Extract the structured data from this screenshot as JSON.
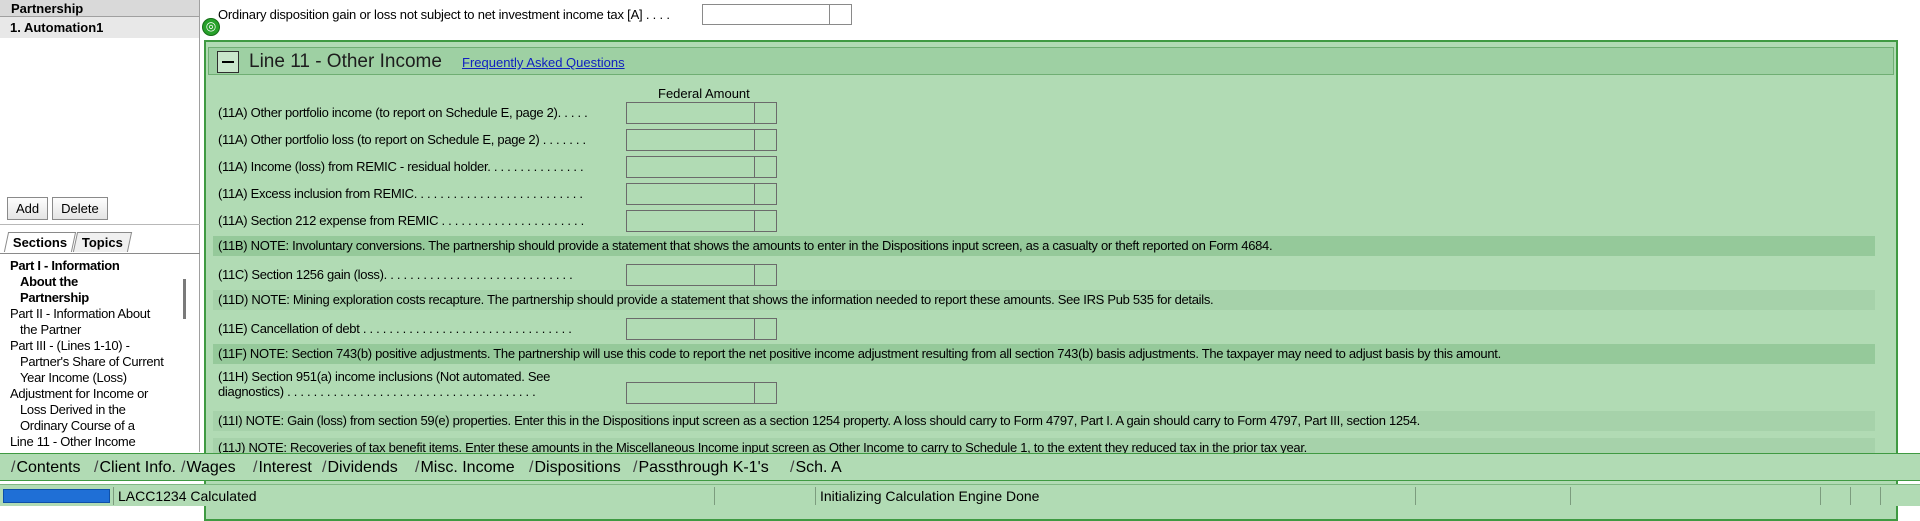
{
  "left_panel": {
    "header": "Partnership",
    "selected_item": "1. Automation1",
    "add_label": "Add",
    "delete_label": "Delete",
    "tabs": [
      {
        "label": "Sections",
        "active": true
      },
      {
        "label": "Topics",
        "active": false
      }
    ],
    "sections": [
      {
        "first": "Part I - Information",
        "rest": [
          "About the",
          "Partnership"
        ],
        "bold": true
      },
      {
        "first": "Part II - Information About",
        "rest": [
          "the Partner"
        ],
        "bold": false
      },
      {
        "first": "Part III - (Lines 1-10) -",
        "rest": [
          "Partner's Share of Current",
          "Year Income (Loss)"
        ],
        "bold": false
      },
      {
        "first": "Adjustment for Income or",
        "rest": [
          "Loss Derived in the",
          "Ordinary Course of a"
        ],
        "bold": false
      },
      {
        "first": "Line 11 - Other Income",
        "rest": [],
        "bold": false
      }
    ]
  },
  "top_row": {
    "label": "Ordinary disposition gain or loss not subject to net investment income tax [A] . . . .",
    "value": ""
  },
  "section": {
    "title": "Line 11 - Other Income",
    "faq_link": "Frequently Asked Questions",
    "column_header": "Federal Amount",
    "rows": [
      {
        "type": "field",
        "label": "(11A) Other portfolio income (to report on Schedule E, page 2). . . . .",
        "value": ""
      },
      {
        "type": "field",
        "label": "(11A) Other portfolio loss (to report on Schedule E, page 2) . . . . . . .",
        "value": ""
      },
      {
        "type": "field",
        "label": "(11A) Income (loss) from REMIC - residual holder. . . . . . . . . . . . . . .",
        "value": ""
      },
      {
        "type": "field",
        "label": "(11A) Excess inclusion from REMIC. . . . . . . . . . . . . . . . . . . . . . . . . .",
        "value": ""
      },
      {
        "type": "field",
        "label": "(11A) Section 212 expense from REMIC . . . . . . . . . . . . . . . . . . . . . .",
        "value": ""
      },
      {
        "type": "note",
        "label": "(11B) NOTE: Involuntary conversions. The partnership should provide a statement that shows the amounts to enter in the Dispositions input screen, as a casualty or theft reported on Form 4684."
      },
      {
        "type": "field",
        "label": "(11C) Section 1256 gain (loss). . . . . . . . . . . . . . . . . . . . . . . . . . . . .",
        "value": ""
      },
      {
        "type": "note",
        "label": "(11D) NOTE: Mining exploration costs recapture. The partnership should provide a statement that shows the information needed to report these amounts. See IRS Pub 535 for details."
      },
      {
        "type": "field",
        "label": "(11E) Cancellation of debt . . . . . . . . . . . . . . . . . . . . . . . . . . . . . . . .",
        "value": ""
      },
      {
        "type": "note",
        "label": "(11F) NOTE: Section 743(b) positive adjustments. The partnership will use this code to report the net positive income adjustment resulting from all section 743(b) basis adjustments. The taxpayer may need to adjust basis by this amount."
      },
      {
        "type": "field2",
        "label": "(11H) Section 951(a) income inclusions (Not automated. See",
        "label2": "diagnostics) . . . . . . . . . . . . . . . . . . . . . . . . . . . . . . . . . . . . . .",
        "value": ""
      },
      {
        "type": "note",
        "label": "(11I) NOTE: Gain (loss) from section 59(e) properties. Enter this in the Dispositions input screen as a section 1254 property. A loss should carry to Form 4797, Part I. A gain should carry to Form 4797, Part III, section 1254."
      },
      {
        "type": "note",
        "label": "(11J) NOTE: Recoveries of tax benefit items. Enter these amounts in the Miscellaneous Income input screen as Other Income to carry to Schedule 1, to the extent they reduced tax in the prior tax year."
      }
    ]
  },
  "bottom_tabs": [
    "Contents",
    "Client Info.",
    "Wages",
    "Interest",
    "Dividends",
    "Misc. Income",
    "Dispositions",
    "Passthrough K-1's",
    "Sch. A"
  ],
  "status": {
    "progress": 1.0,
    "return_id": "LACC1234 Calculated",
    "message": "Initializing Calculation Engine Done"
  }
}
